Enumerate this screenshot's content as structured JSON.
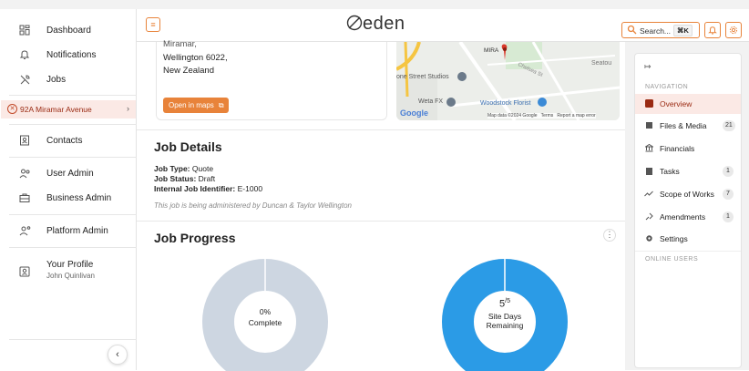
{
  "sidebar": {
    "items": [
      {
        "label": "Dashboard",
        "icon": "dashboard-icon"
      },
      {
        "label": "Notifications",
        "icon": "bell-icon"
      },
      {
        "label": "Jobs",
        "icon": "tools-icon"
      },
      {
        "label": "Contacts",
        "icon": "contacts-icon"
      },
      {
        "label": "User Admin",
        "icon": "users-icon"
      },
      {
        "label": "Business Admin",
        "icon": "briefcase-icon"
      },
      {
        "label": "Platform Admin",
        "icon": "platform-admin-icon"
      }
    ],
    "current_job": "92A Miramar Avenue",
    "profile": {
      "title": "Your Profile",
      "name": "John Quinlivan"
    },
    "collapse_glyph": "‹"
  },
  "topbar": {
    "logo": "eden",
    "search_label": "Search...",
    "search_shortcut": "⌘K"
  },
  "address": {
    "lines": [
      "Miramar,",
      "Wellington 6022,",
      "New Zealand"
    ],
    "open_maps_label": "Open in maps"
  },
  "map": {
    "labels": [
      "MIRA",
      "Seatou",
      "one Street Studios",
      "Weta FX",
      "Woodstock Florist",
      "Chelsea St"
    ],
    "google": "Google",
    "footer": "Map data ©2024 Google   Terms   Report a map error"
  },
  "job_details": {
    "title": "Job Details",
    "fields": [
      {
        "key": "Job Type:",
        "value": "Quote"
      },
      {
        "key": "Job Status:",
        "value": "Draft"
      },
      {
        "key": "Internal Job Identifier:",
        "value": "E-1000"
      }
    ],
    "note": "This job is being administered by Duncan & Taylor Wellington"
  },
  "job_progress": {
    "title": "Job Progress",
    "complete_pct": "0%",
    "complete_label": "Complete",
    "days_value": "5",
    "days_total": "5",
    "days_label_1": "Site Days",
    "days_label_2": "Remaining",
    "colors": {
      "complete": "#cdd6e1",
      "days": "#2b9be6"
    },
    "complete_fraction": 0,
    "days_fraction": 1
  },
  "right_nav": {
    "heading": "NAVIGATION",
    "items": [
      {
        "label": "Overview",
        "icon": "overview-icon",
        "badge": ""
      },
      {
        "label": "Files & Media",
        "icon": "files-icon",
        "badge": "21"
      },
      {
        "label": "Financials",
        "icon": "bank-icon",
        "badge": ""
      },
      {
        "label": "Tasks",
        "icon": "clipboard-icon",
        "badge": "1"
      },
      {
        "label": "Scope of Works",
        "icon": "trend-icon",
        "badge": "7"
      },
      {
        "label": "Amendments",
        "icon": "amendments-icon",
        "badge": "1"
      },
      {
        "label": "Settings",
        "icon": "gear-icon",
        "badge": ""
      }
    ],
    "online_heading": "ONLINE USERS"
  },
  "colors": {
    "accent": "#e8833a",
    "active_bg": "#fbe9e5",
    "progress_blue": "#2b9be6"
  }
}
